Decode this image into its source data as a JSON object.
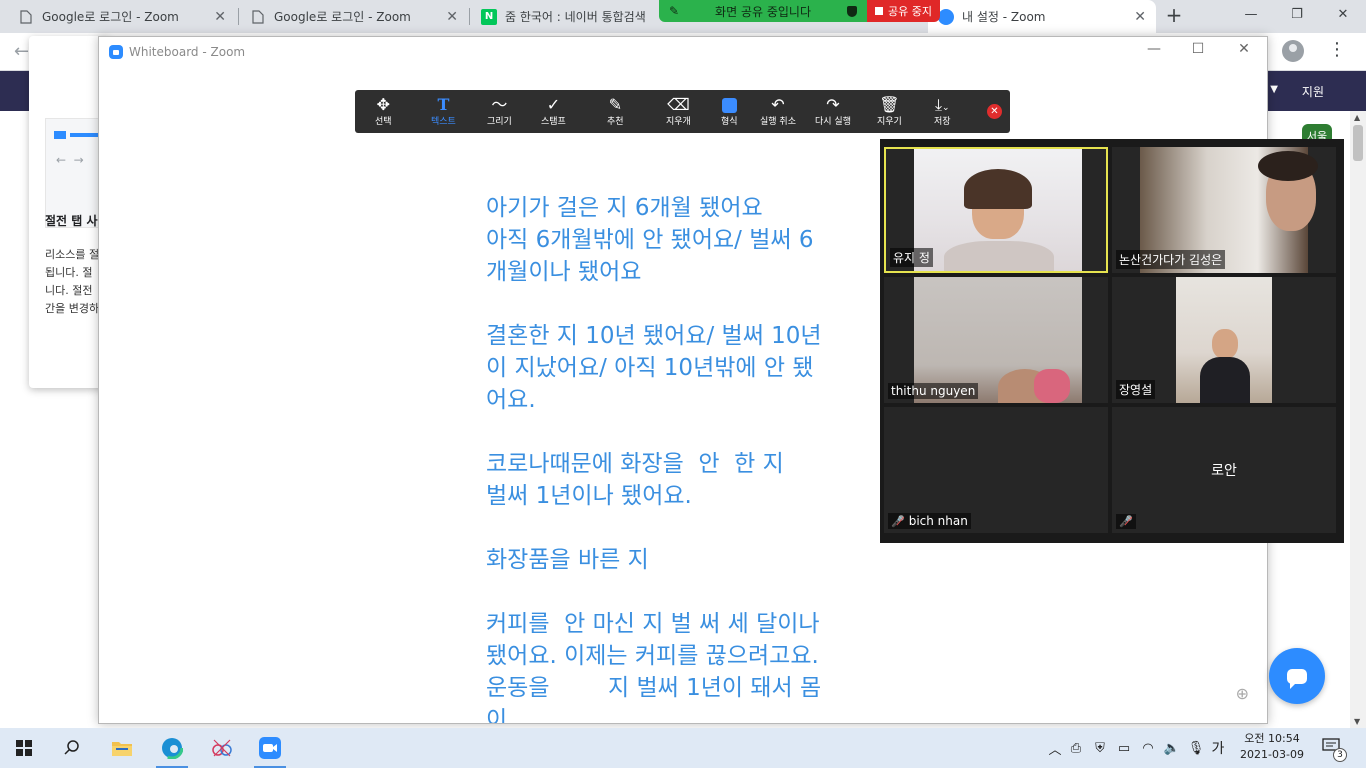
{
  "browser": {
    "tabs": [
      {
        "title": "Google로 로그인 - Zoom"
      },
      {
        "title": "Google로 로그인 - Zoom"
      },
      {
        "title": "줌 한국어 : 네이버 통합검색"
      },
      {
        "title": "내 설정 - Zoom"
      }
    ],
    "new_tab_label": "+",
    "window_controls": [
      "—",
      "❐",
      "✕"
    ]
  },
  "share_banner": {
    "message": "화면 공유 중입니다",
    "stop_label": "공유 중지"
  },
  "site": {
    "support_label": "지원",
    "badge_label": "서울",
    "popup": {
      "title": "절전 탭 사",
      "text": "리소스를 절\n됩니다. 절\n니다. 절전\n간을 변경하"
    }
  },
  "whiteboard": {
    "window_title": "Whiteboard - Zoom",
    "toolbar": [
      {
        "label": "선택",
        "icon": "move-icon"
      },
      {
        "label": "텍스트",
        "icon": "text-icon",
        "selected": true
      },
      {
        "label": "그리기",
        "icon": "draw-icon"
      },
      {
        "label": "스탬프",
        "icon": "stamp-icon"
      },
      {
        "label": "추천",
        "icon": "spotlight-icon"
      },
      {
        "label": "지우개",
        "icon": "eraser-icon"
      },
      {
        "label": "형식",
        "icon": "format-icon"
      },
      {
        "label": "실행 취소",
        "icon": "undo-icon"
      },
      {
        "label": "다시 실행",
        "icon": "redo-icon"
      },
      {
        "label": "지우기",
        "icon": "trash-icon"
      },
      {
        "label": "저장",
        "icon": "save-icon"
      }
    ],
    "text_color": "#3a8fe0",
    "paragraphs": [
      [
        "아기가 걸은 지 6개월 됐어요",
        "아직 6개월밖에 안 됐어요/ 벌써 6",
        "개월이나 됐어요"
      ],
      [
        "결혼한 지 10년 됐어요/ 벌써 10년",
        "이 지났어요/ 아직 10년밖에 안 됐",
        "어요."
      ],
      [
        "코로나때문에 화장을  안  한 지",
        "벌써 1년이나 됐어요."
      ],
      [
        "화장품을 바른 지"
      ],
      [
        "커피를  안 마신 지 벌 써 세 달이나",
        "됐어요. 이제는 커피를 끊으려고요.",
        "운동을        지 벌써 1년이 돼서 몸",
        "이"
      ]
    ]
  },
  "gallery": {
    "participants": [
      {
        "name": "유지 정",
        "active": true,
        "video": true
      },
      {
        "name": "논산건가다가 김성은",
        "video": true
      },
      {
        "name": "thithu nguyen",
        "video": true
      },
      {
        "name": "장영설",
        "video": true
      },
      {
        "name": "bich nhan",
        "muted": true,
        "video": false
      },
      {
        "name": "로안",
        "muted": true,
        "video": false
      }
    ]
  },
  "taskbar": {
    "apps": [
      "start-icon",
      "search-icon",
      "file-explorer-icon",
      "edge-icon",
      "snip-icon",
      "zoom-icon"
    ],
    "ime": "가",
    "time": "오전 10:54",
    "date": "2021-03-09",
    "notifications": "3"
  }
}
